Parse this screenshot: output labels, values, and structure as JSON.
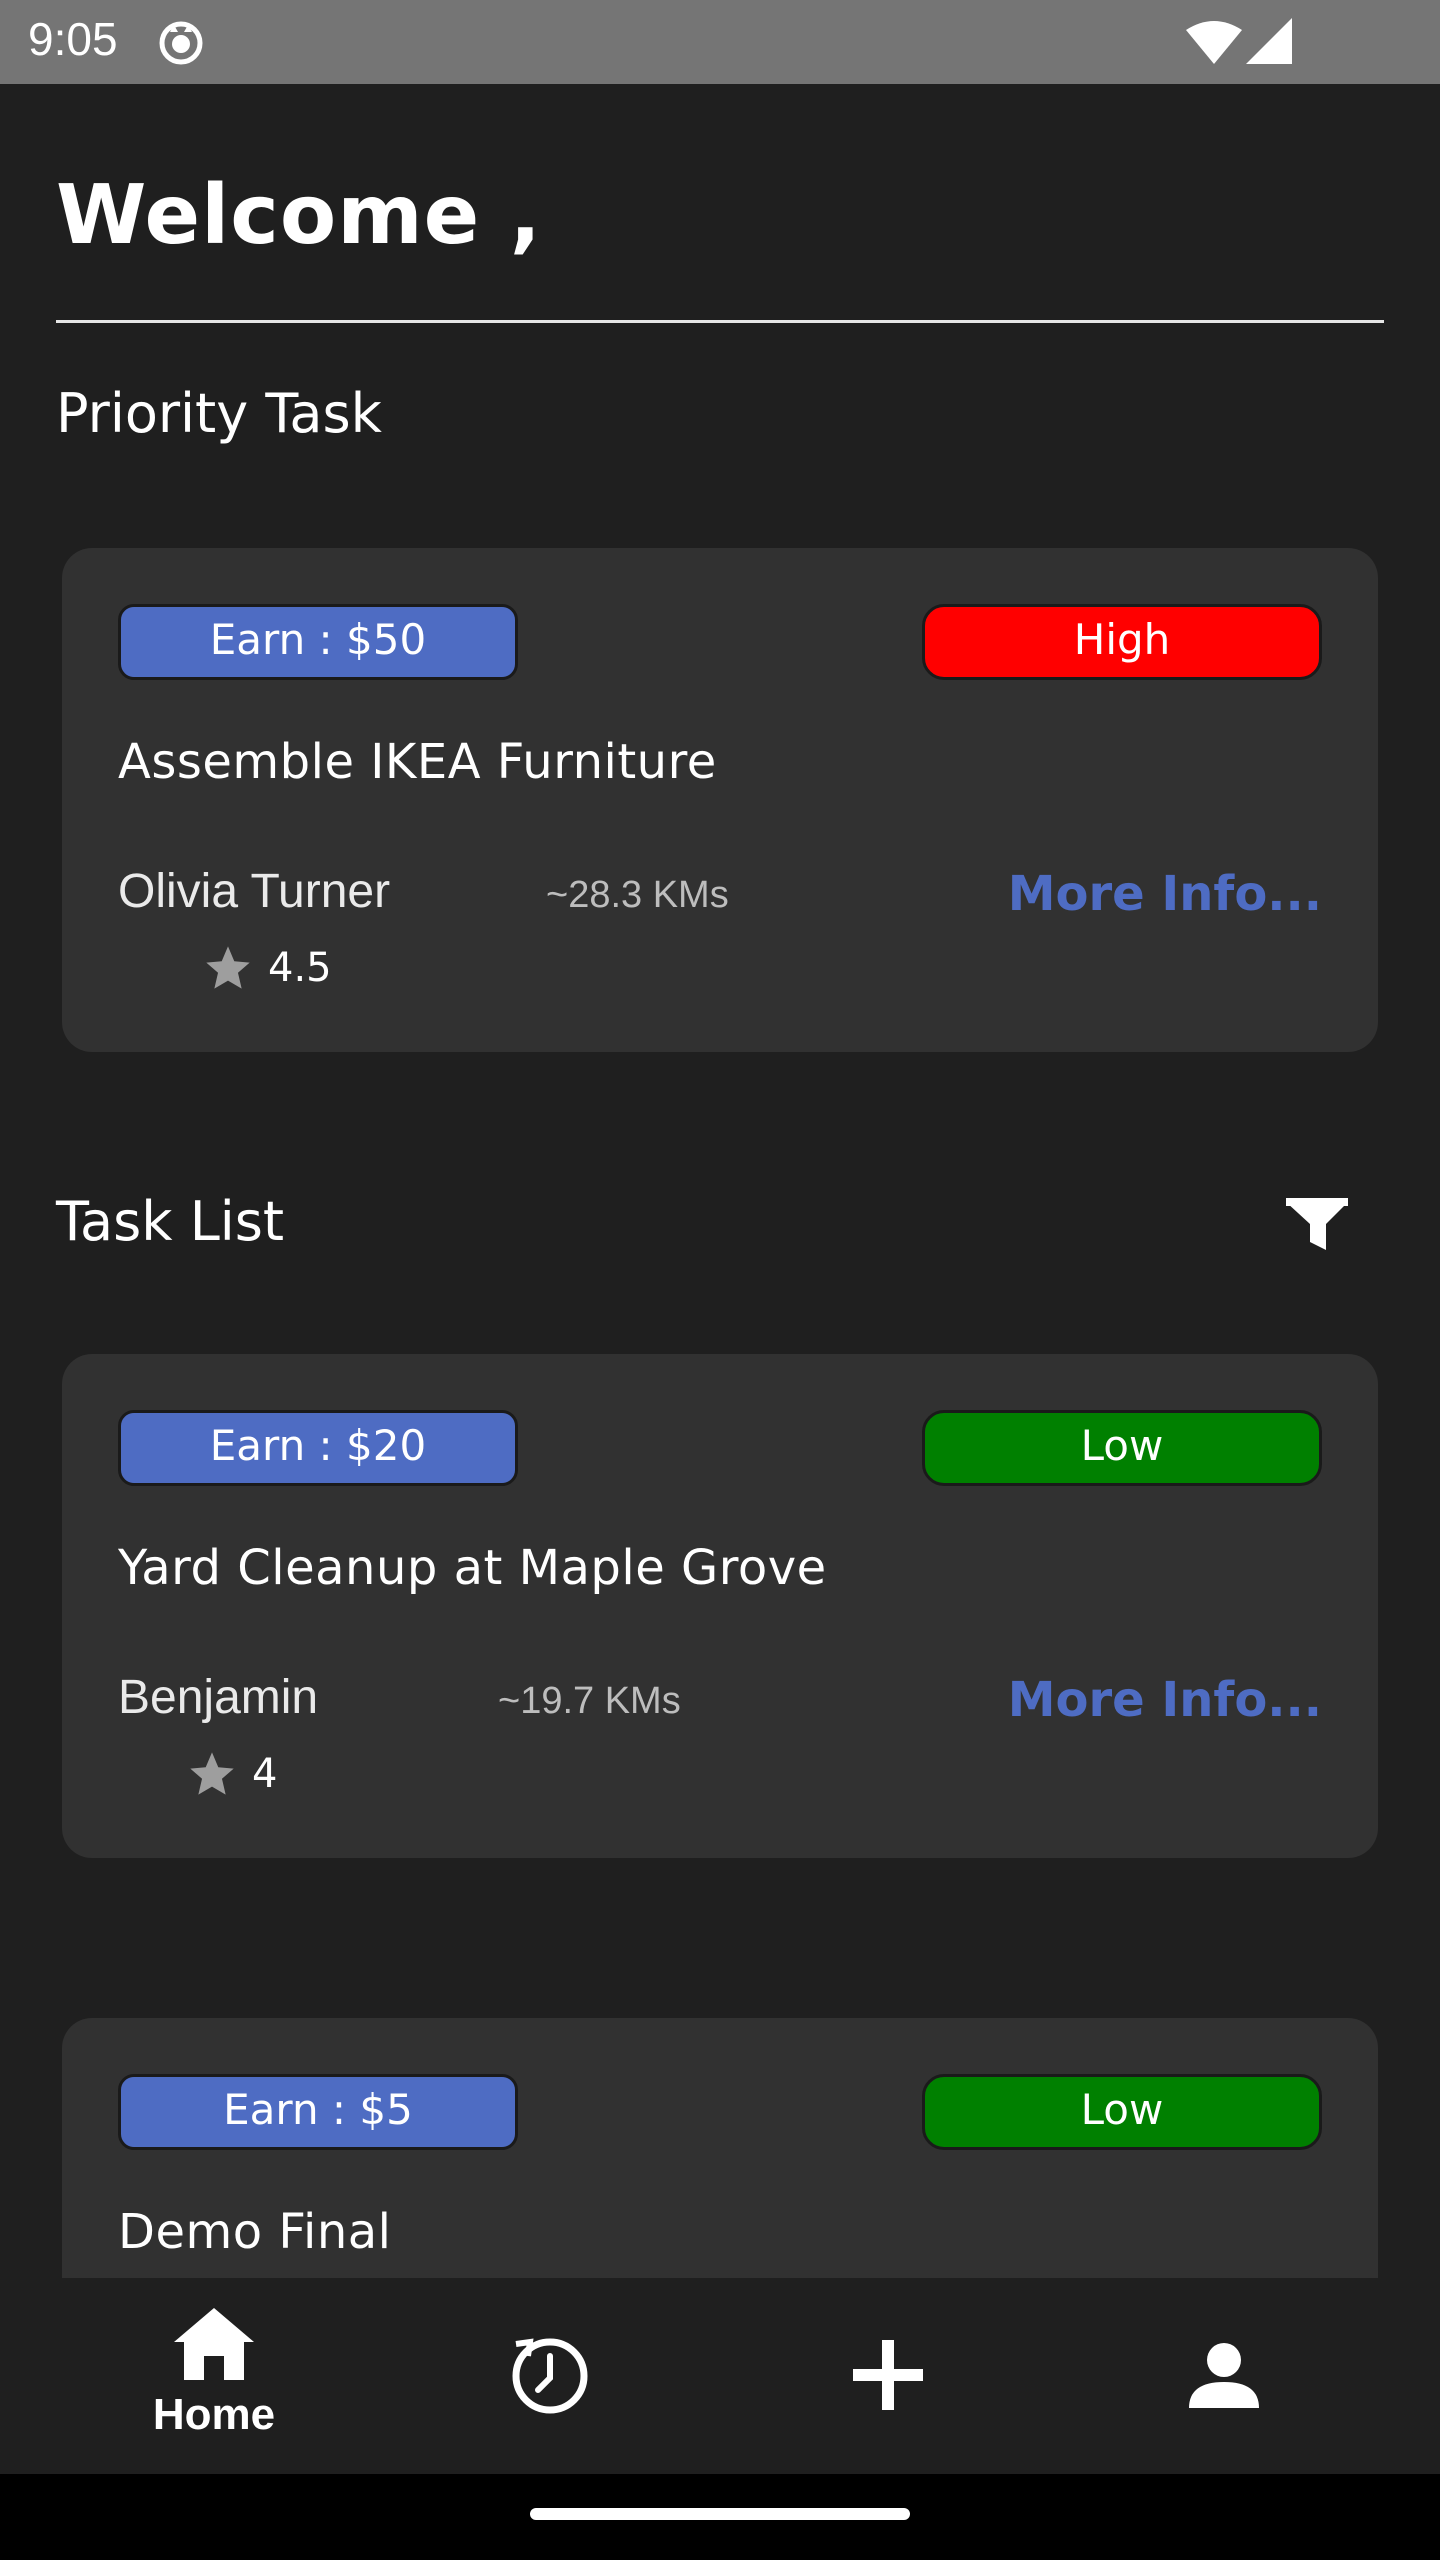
{
  "status_bar": {
    "time": "9:05",
    "icons": [
      "app-notification-icon",
      "wifi-icon",
      "cell-signal-icon"
    ]
  },
  "header": {
    "welcome": "Welcome ,"
  },
  "priority_section": {
    "title": "Priority Task",
    "card": {
      "earn": "Earn : $50",
      "priority": "High",
      "title": "Assemble IKEA Furniture",
      "poster": "Olivia Turner",
      "distance": "~28.3 KMs",
      "more_info": "More Info...",
      "rating": "4.5"
    }
  },
  "task_list": {
    "title": "Task List",
    "filter_icon": "filter-icon",
    "cards": [
      {
        "earn": "Earn : $20",
        "priority": "Low",
        "title": "Yard Cleanup at Maple Grove",
        "poster": "Benjamin",
        "distance": "~19.7 KMs",
        "more_info": "More Info...",
        "rating": "4"
      },
      {
        "earn": "Earn : $5",
        "priority": "Low",
        "title": "Demo Final"
      }
    ]
  },
  "bottom_nav": {
    "items": [
      {
        "icon": "home-icon",
        "label": "Home",
        "active": true
      },
      {
        "icon": "history-icon",
        "label": ""
      },
      {
        "icon": "add-icon",
        "label": ""
      },
      {
        "icon": "profile-icon",
        "label": ""
      }
    ]
  },
  "colors": {
    "background": "#1f1f1f",
    "card": "#313131",
    "accent_blue": "#4e6cc3",
    "high": "#ff0000",
    "low": "#008000"
  }
}
